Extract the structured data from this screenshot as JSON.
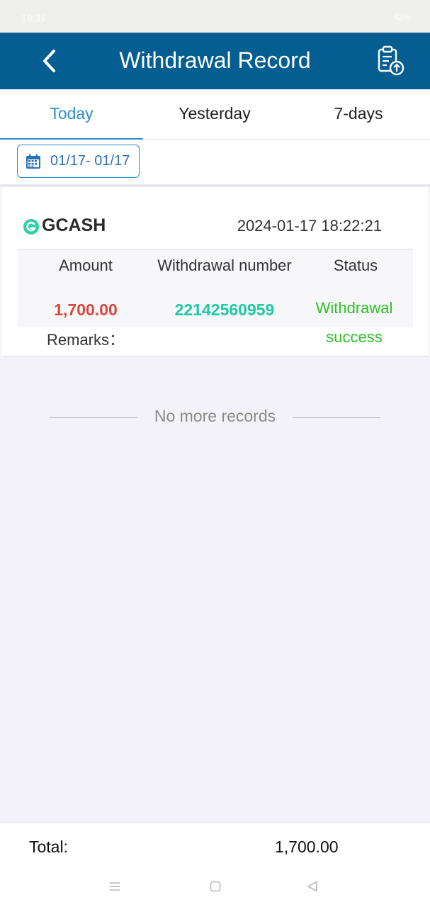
{
  "status_bar": {
    "time": "18:31",
    "indicators": "42%"
  },
  "header": {
    "title": "Withdrawal Record",
    "back_icon": "chevron-left-icon",
    "action_icon": "clipboard-upload-icon"
  },
  "tabs": [
    {
      "label": "Today",
      "active": true
    },
    {
      "label": "Yesterday",
      "active": false
    },
    {
      "label": "7-days",
      "active": false
    }
  ],
  "date_range": {
    "label": "01/17- 01/17",
    "icon": "calendar-icon"
  },
  "records": [
    {
      "method": "GCASH",
      "method_icon": "gcash-logo-icon",
      "datetime": "2024-01-17 18:22:21",
      "columns": {
        "amount": "Amount",
        "number": "Withdrawal number",
        "status": "Status"
      },
      "amount": "1,700.00",
      "number": "22142560959",
      "status_line1": "Withdrawal",
      "status_line2": "success",
      "remarks_label": "Remarks："
    }
  ],
  "end_message": "No more records",
  "footer": {
    "total_label": "Total:",
    "total_value": "1,700.00"
  },
  "colors": {
    "header_bg": "#045e91",
    "accent": "#2a8dc9",
    "amount": "#d9473a",
    "number": "#1ec9a8",
    "success": "#2fc12a"
  }
}
